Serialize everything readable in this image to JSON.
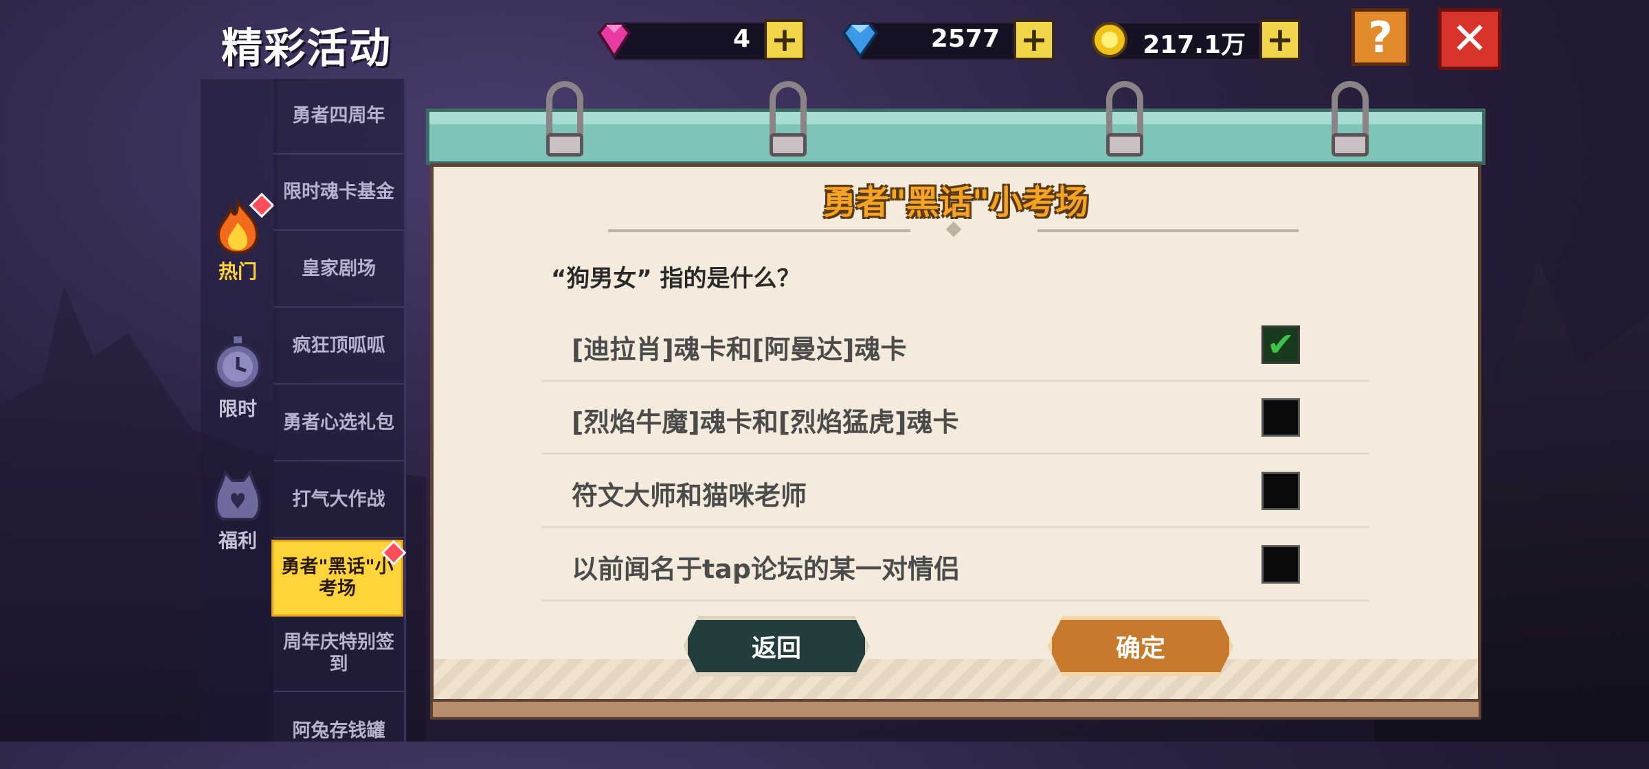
{
  "header": {
    "title": "精彩活动"
  },
  "resources": [
    {
      "name": "pink-gem",
      "value": "4",
      "color": "#e83aa3"
    },
    {
      "name": "blue-diamond",
      "value": "2577",
      "color": "#3a9ae8"
    },
    {
      "name": "gold-coin",
      "value": "217.1万",
      "color": "#f0c21a"
    }
  ],
  "categories": [
    {
      "label": "热门",
      "icon": "fire-icon",
      "active": true,
      "badge": true
    },
    {
      "label": "限时",
      "icon": "clock-icon",
      "active": false
    },
    {
      "label": "福利",
      "icon": "bag-icon",
      "active": false
    }
  ],
  "events": [
    {
      "label": "勇者四周年"
    },
    {
      "label": "限时魂卡基金"
    },
    {
      "label": "皇家剧场"
    },
    {
      "label": "疯狂顶呱呱"
    },
    {
      "label": "勇者心选礼包"
    },
    {
      "label": "打气大作战"
    },
    {
      "label": "勇者\"黑话\"小考场",
      "active": true,
      "badge": true
    },
    {
      "label": "周年庆特别签到"
    },
    {
      "label": "阿兔存钱罐"
    }
  ],
  "quiz": {
    "title": "勇者\"黑话\"小考场",
    "question": "“狗男女” 指的是什么？",
    "options": [
      {
        "text": "[迪拉肖]魂卡和[阿曼达]魂卡",
        "checked": true
      },
      {
        "text": "[烈焰牛魔]魂卡和[烈焰猛虎]魂卡",
        "checked": false
      },
      {
        "text": "符文大师和猫咪老师",
        "checked": false
      },
      {
        "text": "以前闻名于tap论坛的某一对情侣",
        "checked": false
      }
    ],
    "back_label": "返回",
    "confirm_label": "确定"
  },
  "toolbar": {
    "help_label": "?",
    "close_label": "✕"
  }
}
